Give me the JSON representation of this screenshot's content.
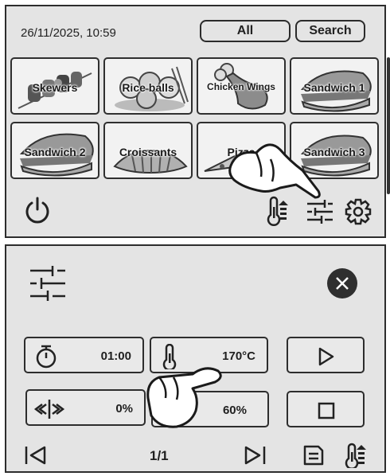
{
  "top_panel": {
    "datetime": "26/11/2025, 10:59",
    "all_label": "All",
    "search_label": "Search",
    "recipes": [
      {
        "label": "Skewers"
      },
      {
        "label": "Rice balls"
      },
      {
        "label": "Chicken Wings"
      },
      {
        "label": "Sandwich 1"
      },
      {
        "label": "Sandwich 2"
      },
      {
        "label": "Croissants"
      },
      {
        "label": "Pizza"
      },
      {
        "label": "Sandwich 3"
      }
    ],
    "icons": {
      "power": "power-icon",
      "thermometer": "thermometer-up-icon",
      "sliders": "sliders-icon",
      "settings": "gear-icon"
    }
  },
  "bottom_panel": {
    "timer_value": "01:00",
    "temperature_value": "170°C",
    "fan_value": "0%",
    "humidity_value": "60%",
    "page_indicator": "1/1",
    "icons": {
      "sliders": "sliders-icon",
      "close": "close-icon",
      "timer": "stopwatch-icon",
      "thermometer": "thermometer-icon",
      "fan": "fan-icon",
      "play": "play-icon",
      "stop": "stop-icon",
      "prev": "first-page-icon",
      "next": "last-page-icon",
      "save": "save-icon",
      "probe": "thermometer-up-icon"
    }
  }
}
